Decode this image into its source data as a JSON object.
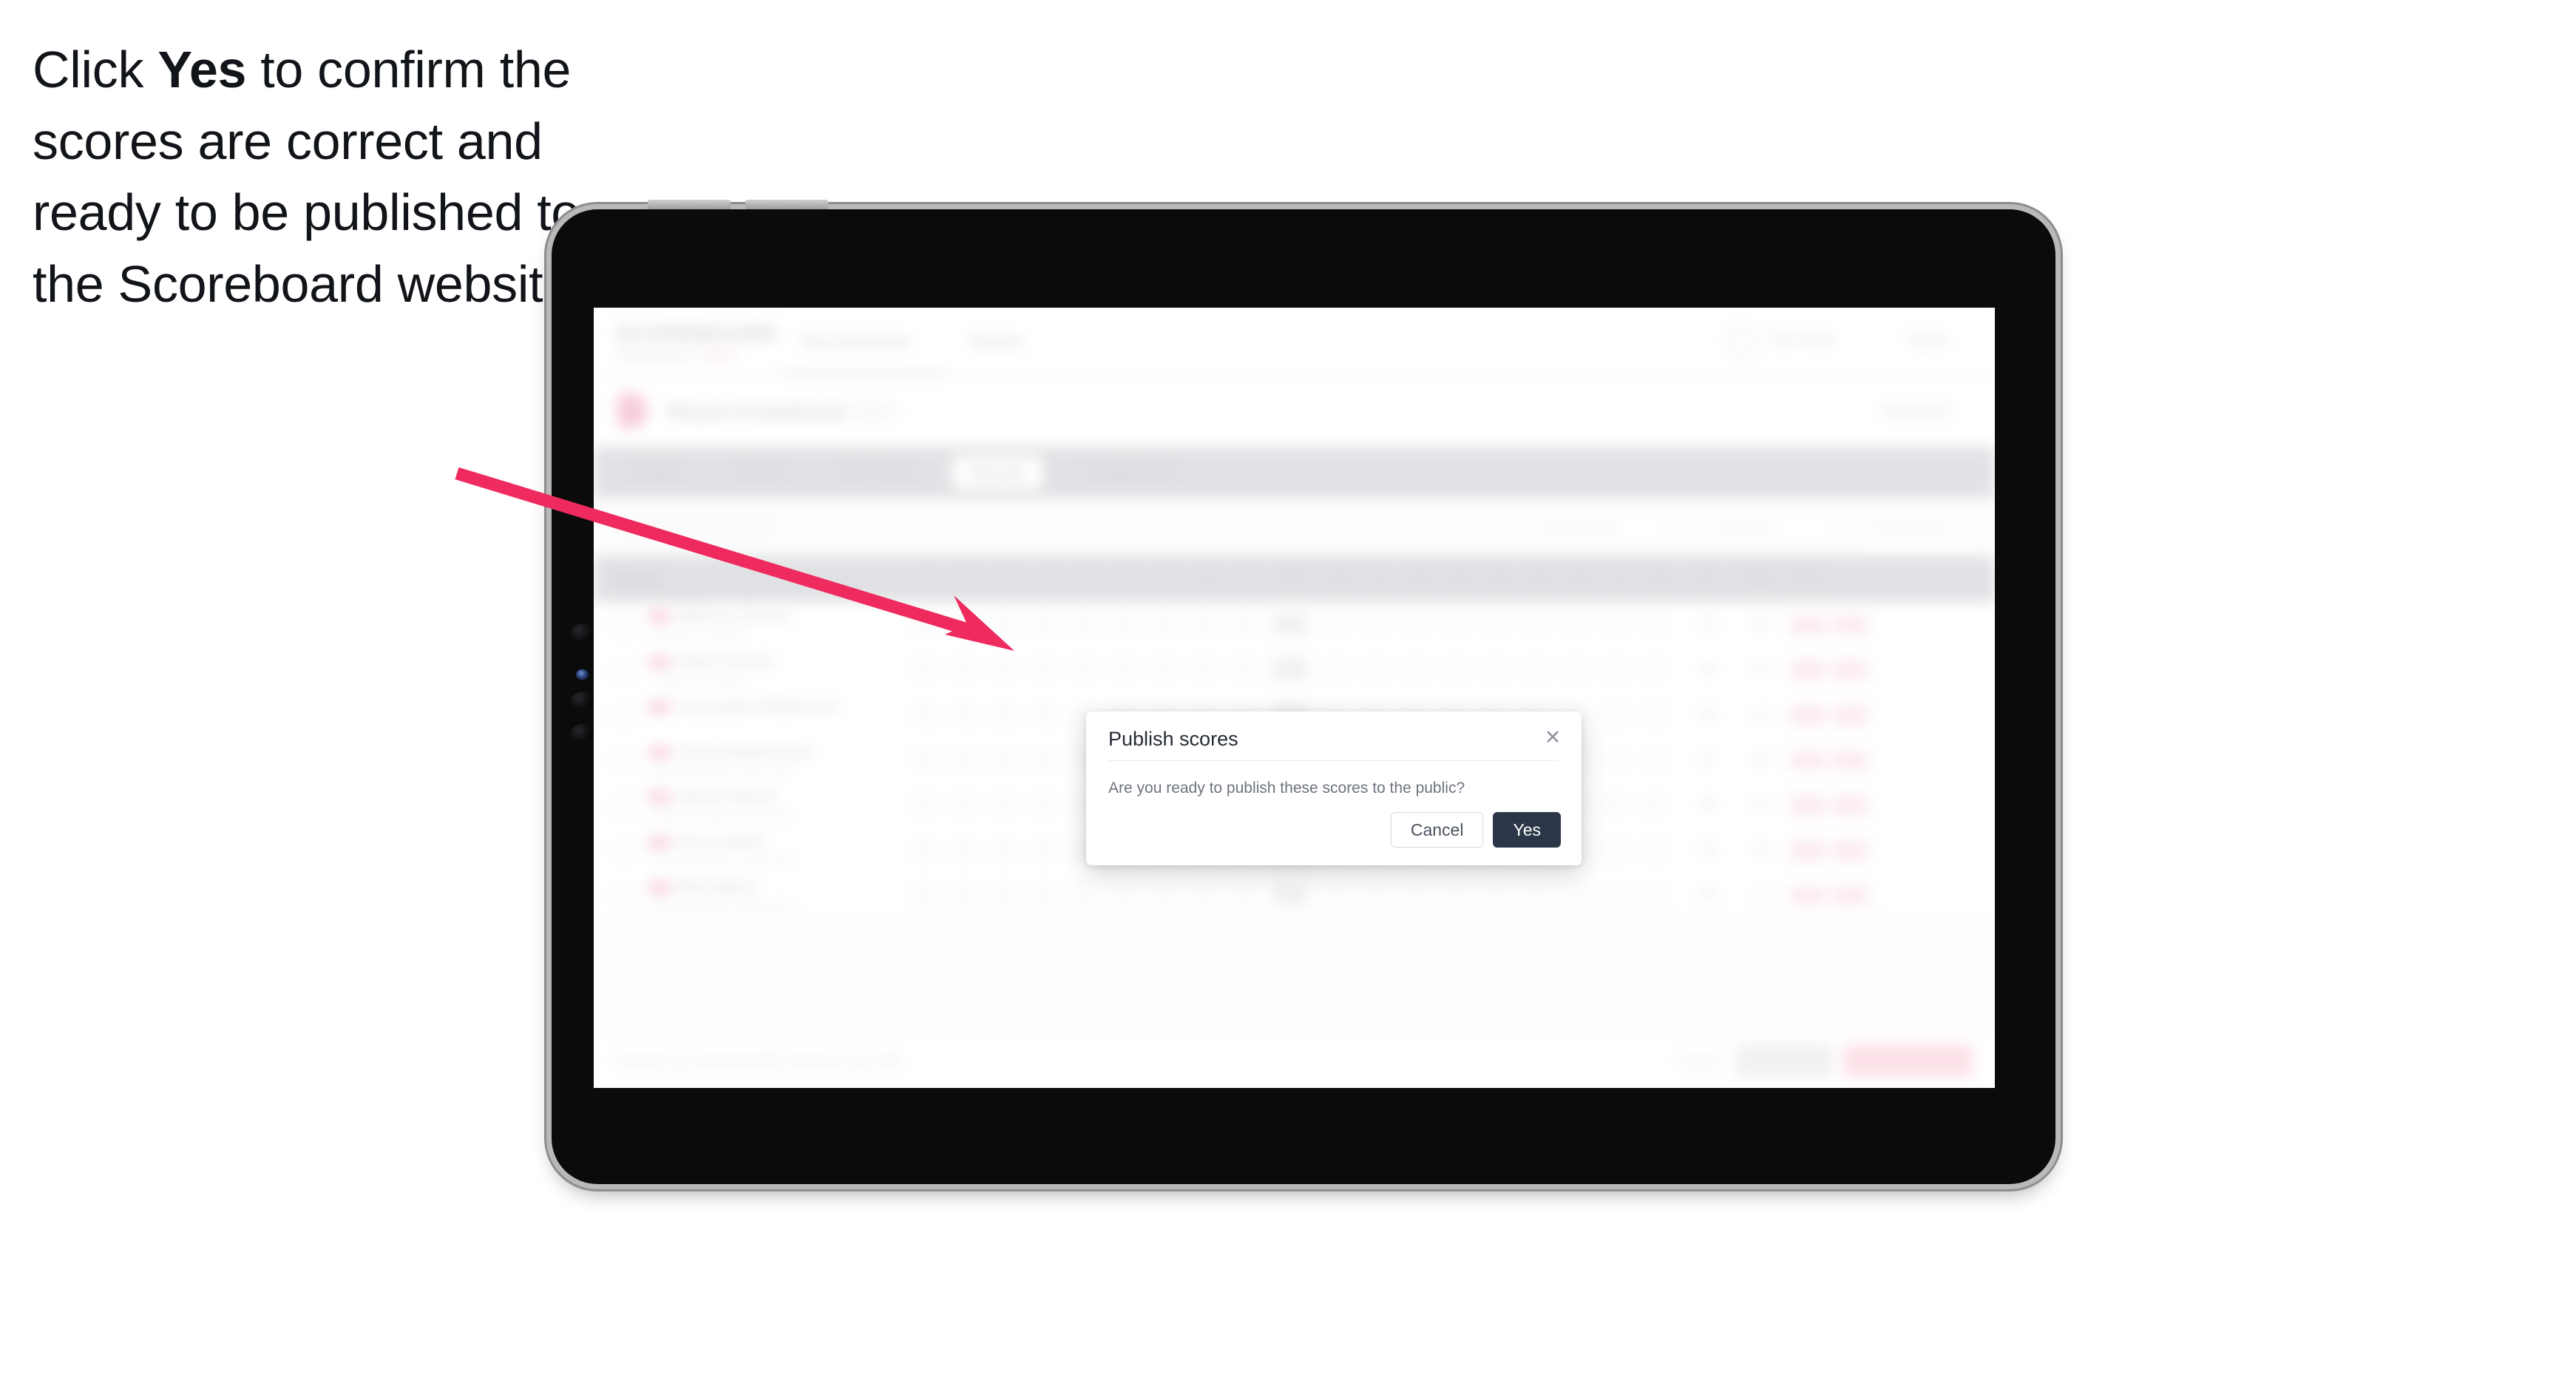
{
  "caption": {
    "before": "Click ",
    "bold": "Yes",
    "after": " to confirm the scores are correct and ready to be published to the Scoreboard website."
  },
  "annotation": {
    "arrow_color": "#ef2a5e",
    "arrow_name": "pointer-arrow"
  },
  "device": {
    "type": "tablet",
    "frame_color": "#0b0b0b",
    "rim_color": "#a9a9a9"
  },
  "app": {
    "header": {
      "brand": "SCOREBOARD",
      "brand_sub": "POWERED BY",
      "brand_sub_accent": "GOLF",
      "nav": [
        {
          "label": "Tournaments"
        },
        {
          "label": "Teams"
        }
      ],
      "right_items": [
        {
          "label": "Get Help"
        },
        {
          "label": "Menu"
        }
      ],
      "globe_icon": "globe-icon"
    },
    "title_bar": {
      "tournament": "Royal Invitational",
      "tournament_meta": "2024",
      "right_meta": "Round 2"
    },
    "tabs": [
      {
        "label": "Details",
        "selected": false
      },
      {
        "label": "Teams",
        "selected": false
      },
      {
        "label": "Tee Times",
        "selected": false
      },
      {
        "label": "Results",
        "selected": true
      },
      {
        "label": "Leaderboard",
        "selected": false
      }
    ],
    "filters": [
      {
        "label": "All Divisions",
        "icon": "chevron-down-icon"
      },
      {
        "label": "Round 2",
        "icon": "chevron-down-icon"
      },
      {
        "label": "Gross Only",
        "icon": "chevron-down-icon"
      }
    ],
    "search_placeholder": "Search players",
    "table": {
      "columns": [
        "Player",
        "1",
        "2",
        "3",
        "4",
        "5",
        "6",
        "7",
        "8",
        "9",
        "OUT",
        "10",
        "11",
        "12",
        "13",
        "14",
        "15",
        "16",
        "17",
        "18",
        "IN",
        "Total",
        "Score"
      ],
      "rows": [
        {
          "badge": "A1",
          "name": "Melissa Tomsic",
          "club": "Fraser's Friends",
          "scores": [
            "4",
            "5",
            "4",
            "3",
            "5",
            "4",
            "4",
            "3",
            "4"
          ],
          "out": "36",
          "total": "74",
          "score": "+2"
        },
        {
          "badge": "A2",
          "name": "Piper Parnell",
          "club": "Fraser's Friends",
          "scores": [
            "5",
            "4",
            "4",
            "4",
            "4",
            "5",
            "4",
            "4",
            "4"
          ],
          "out": "38",
          "total": "75",
          "score": "+3"
        },
        {
          "badge": "A3",
          "name": "Cassandra Robertson",
          "club": "",
          "scores": [
            "4",
            "4",
            "5",
            "4",
            "4",
            "4",
            "5",
            "3",
            "4"
          ],
          "out": "37",
          "total": "76",
          "score": "+4"
        },
        {
          "badge": "B1",
          "name": "Chris Stephenson",
          "club": "Bournemouth Lunar Golf",
          "scores": [
            "4",
            "5",
            "4",
            "5",
            "4",
            "4",
            "4",
            "4",
            "5"
          ],
          "out": "39",
          "total": "77",
          "score": "+5"
        },
        {
          "badge": "B2",
          "name": "Darren Quinn",
          "club": "Bournemouth Lunar Golf",
          "scores": [
            "5",
            "4",
            "4",
            "4",
            "5",
            "4",
            "4",
            "5",
            "4"
          ],
          "out": "39",
          "total": "78",
          "score": "+6"
        },
        {
          "badge": "B3",
          "name": "Rose Heath",
          "club": "Bournemouth Lunar Golf",
          "scores": [
            "4",
            "4",
            "5",
            "4",
            "4",
            "5",
            "4",
            "4",
            "4"
          ],
          "out": "38",
          "total": "76",
          "score": "+4"
        },
        {
          "badge": "C1",
          "name": "Bob Baker",
          "club": "Bournemouth Lunar Golf",
          "scores": [
            "5",
            "5",
            "4",
            "4",
            "4",
            "4",
            "5",
            "4",
            "4"
          ],
          "out": "39",
          "total": "79",
          "score": "+7"
        }
      ]
    },
    "footer": {
      "note": "Results are automatically saved as you edit",
      "link": "Cancel",
      "secondary_button": "Save",
      "primary_button": "Publish to Scoreboard"
    }
  },
  "modal": {
    "title": "Publish scores",
    "body": "Are you ready to publish these scores to the public?",
    "close_icon": "close-icon",
    "cancel_label": "Cancel",
    "confirm_label": "Yes",
    "confirm_color": "#2b3648"
  }
}
